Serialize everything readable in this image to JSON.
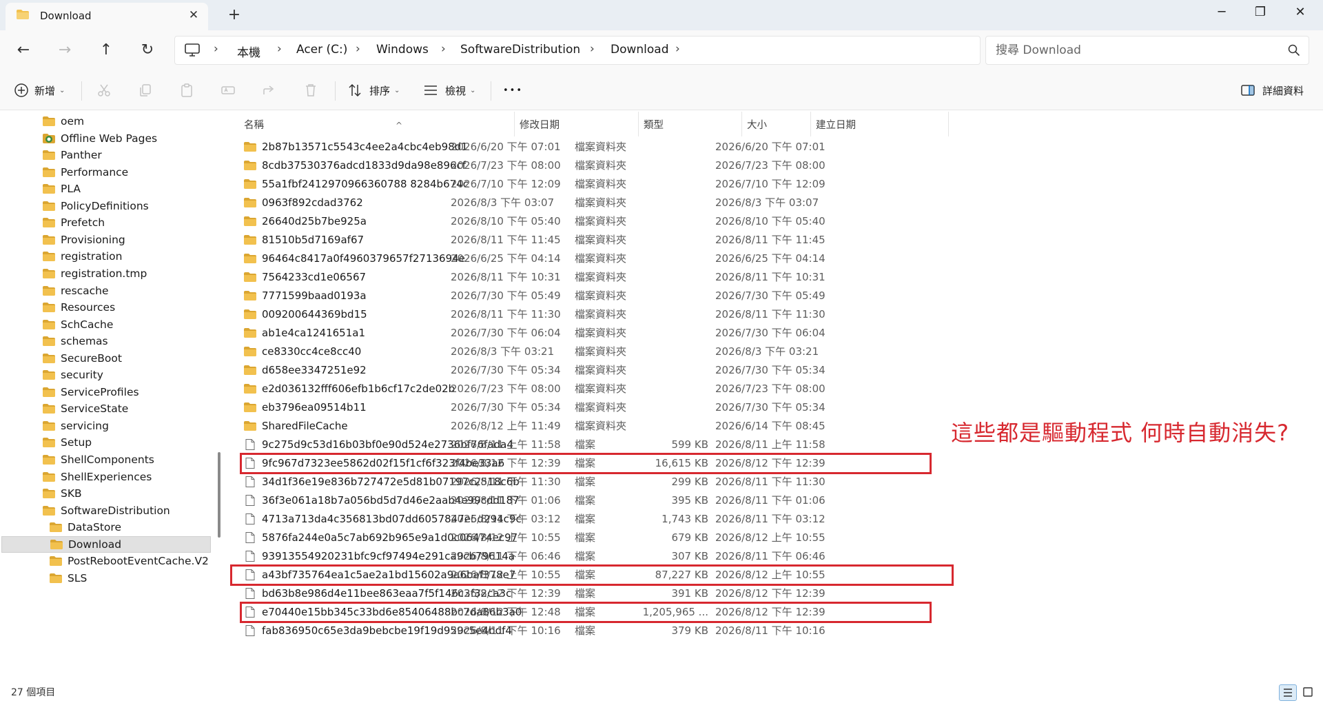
{
  "window": {
    "tab_title": "Download",
    "new_tab_glyph": "+",
    "close_tab_glyph": "✕",
    "minimize_glyph": "─",
    "restore_glyph": "❐",
    "close_glyph": "✕"
  },
  "nav": {
    "back_glyph": "←",
    "forward_glyph": "→",
    "up_glyph": "↑",
    "refresh_glyph": "↻",
    "separator_glyph": "›",
    "breadcrumbs": [
      "本機",
      "Acer (C:)",
      "Windows",
      "SoftwareDistribution",
      "Download"
    ],
    "search_placeholder": "搜尋 Download"
  },
  "commandbar": {
    "new_label": "新增",
    "sort_label": "排序",
    "view_label": "檢視",
    "more_label": "•••",
    "details_label": "詳細資料",
    "chevron": "⌄"
  },
  "tree": [
    {
      "label": "oem",
      "level": 1
    },
    {
      "label": "Offline Web Pages",
      "level": 1,
      "special": true
    },
    {
      "label": "Panther",
      "level": 1
    },
    {
      "label": "Performance",
      "level": 1
    },
    {
      "label": "PLA",
      "level": 1
    },
    {
      "label": "PolicyDefinitions",
      "level": 1
    },
    {
      "label": "Prefetch",
      "level": 1
    },
    {
      "label": "Provisioning",
      "level": 1
    },
    {
      "label": "registration",
      "level": 1
    },
    {
      "label": "registration.tmp",
      "level": 1
    },
    {
      "label": "rescache",
      "level": 1
    },
    {
      "label": "Resources",
      "level": 1
    },
    {
      "label": "SchCache",
      "level": 1
    },
    {
      "label": "schemas",
      "level": 1
    },
    {
      "label": "SecureBoot",
      "level": 1
    },
    {
      "label": "security",
      "level": 1
    },
    {
      "label": "ServiceProfiles",
      "level": 1
    },
    {
      "label": "ServiceState",
      "level": 1
    },
    {
      "label": "servicing",
      "level": 1
    },
    {
      "label": "Setup",
      "level": 1
    },
    {
      "label": "ShellComponents",
      "level": 1
    },
    {
      "label": "ShellExperiences",
      "level": 1
    },
    {
      "label": "SKB",
      "level": 1
    },
    {
      "label": "SoftwareDistribution",
      "level": 1
    },
    {
      "label": "DataStore",
      "level": 2
    },
    {
      "label": "Download",
      "level": 2,
      "selected": true
    },
    {
      "label": "PostRebootEventCache.V2",
      "level": 2
    },
    {
      "label": "SLS",
      "level": 2
    }
  ],
  "columns": {
    "name": "名稱",
    "modified": "修改日期",
    "type": "類型",
    "size": "大小",
    "created": "建立日期",
    "sort_glyph": "^"
  },
  "files": [
    {
      "name": "2b87b13571c5543c4ee2a4cbc4eb98d1",
      "modified": "2026/6/20 下午 07:01",
      "type": "檔案資料夾",
      "size": "",
      "created": "2026/6/20 下午 07:01",
      "kind": "folder"
    },
    {
      "name": "8cdb37530376adcd1833d9da98e896cf",
      "modified": "2026/7/23 下午 08:00",
      "type": "檔案資料夾",
      "size": "",
      "created": "2026/7/23 下午 08:00",
      "kind": "folder"
    },
    {
      "name": "55a1fbf2412970966360788 8284b674c",
      "modified": "2026/7/10 下午 12:09",
      "type": "檔案資料夾",
      "size": "",
      "created": "2026/7/10 下午 12:09",
      "kind": "folder"
    },
    {
      "name": "0963f892cdad3762",
      "modified": "2026/8/3 下午 03:07",
      "type": "檔案資料夾",
      "size": "",
      "created": "2026/8/3 下午 03:07",
      "kind": "folder"
    },
    {
      "name": "26640d25b7be925a",
      "modified": "2026/8/10 下午 05:40",
      "type": "檔案資料夾",
      "size": "",
      "created": "2026/8/10 下午 05:40",
      "kind": "folder"
    },
    {
      "name": "81510b5d7169af67",
      "modified": "2026/8/11 下午 11:45",
      "type": "檔案資料夾",
      "size": "",
      "created": "2026/8/11 下午 11:45",
      "kind": "folder"
    },
    {
      "name": "96464c8417a0f4960379657f2713694e",
      "modified": "2026/6/25 下午 04:14",
      "type": "檔案資料夾",
      "size": "",
      "created": "2026/6/25 下午 04:14",
      "kind": "folder"
    },
    {
      "name": "7564233cd1e06567",
      "modified": "2026/8/11 下午 10:31",
      "type": "檔案資料夾",
      "size": "",
      "created": "2026/8/11 下午 10:31",
      "kind": "folder"
    },
    {
      "name": "7771599baad0193a",
      "modified": "2026/7/30 下午 05:49",
      "type": "檔案資料夾",
      "size": "",
      "created": "2026/7/30 下午 05:49",
      "kind": "folder"
    },
    {
      "name": "009200644369bd15",
      "modified": "2026/8/11 下午 11:30",
      "type": "檔案資料夾",
      "size": "",
      "created": "2026/8/11 下午 11:30",
      "kind": "folder"
    },
    {
      "name": "ab1e4ca1241651a1",
      "modified": "2026/7/30 下午 06:04",
      "type": "檔案資料夾",
      "size": "",
      "created": "2026/7/30 下午 06:04",
      "kind": "folder"
    },
    {
      "name": "ce8330cc4ce8cc40",
      "modified": "2026/8/3 下午 03:21",
      "type": "檔案資料夾",
      "size": "",
      "created": "2026/8/3 下午 03:21",
      "kind": "folder"
    },
    {
      "name": "d658ee3347251e92",
      "modified": "2026/7/30 下午 05:34",
      "type": "檔案資料夾",
      "size": "",
      "created": "2026/7/30 下午 05:34",
      "kind": "folder"
    },
    {
      "name": "e2d036132fff606efb1b6cf17c2de02b",
      "modified": "2026/7/23 下午 08:00",
      "type": "檔案資料夾",
      "size": "",
      "created": "2026/7/23 下午 08:00",
      "kind": "folder"
    },
    {
      "name": "eb3796ea09514b11",
      "modified": "2026/7/30 下午 05:34",
      "type": "檔案資料夾",
      "size": "",
      "created": "2026/7/30 下午 05:34",
      "kind": "folder"
    },
    {
      "name": "SharedFileCache",
      "modified": "2026/8/12 上午 11:49",
      "type": "檔案資料夾",
      "size": "",
      "created": "2026/6/14 下午 08:45",
      "kind": "folder"
    },
    {
      "name": "9c275d9c53d16b03bf0e90d524e2736bf76fada4",
      "modified": "2026/8/11 上午 11:58",
      "type": "檔案",
      "size": "599 KB",
      "created": "2026/8/11 上午 11:58",
      "kind": "file"
    },
    {
      "name": "9fc967d7323ee5862d02f15f1cf6f323f4be33a6",
      "modified": "2026/8/12 下午 12:39",
      "type": "檔案",
      "size": "16,615 KB",
      "created": "2026/8/12 下午 12:39",
      "kind": "file"
    },
    {
      "name": "34d1f36e19e836b727472e5d81b07197c2518c6b",
      "modified": "2026/8/11 下午 11:30",
      "type": "檔案",
      "size": "299 KB",
      "created": "2026/8/11 下午 11:30",
      "kind": "file"
    },
    {
      "name": "36f3e061a18b7a056bd5d7d46e2aab4e99cdd187",
      "modified": "2026/8/11 下午 01:06",
      "type": "檔案",
      "size": "395 KB",
      "created": "2026/8/11 下午 01:06",
      "kind": "file"
    },
    {
      "name": "4713a713da4c356813bd07dd6057847e5d294c9c",
      "modified": "2026/8/11 下午 03:12",
      "type": "檔案",
      "size": "1,743 KB",
      "created": "2026/8/11 下午 03:12",
      "kind": "file"
    },
    {
      "name": "5876fa244e0a5c7ab692b965e9a1d0c06474ec97",
      "modified": "2026/8/12 上午 10:55",
      "type": "檔案",
      "size": "679 KB",
      "created": "2026/8/12 上午 10:55",
      "kind": "file"
    },
    {
      "name": "93913554920231bfc9cf97494e291ca9cb79614a",
      "modified": "2026/8/11 下午 06:46",
      "type": "檔案",
      "size": "307 KB",
      "created": "2026/8/11 下午 06:46",
      "kind": "file"
    },
    {
      "name": "a43bf735764ea1c5ae2a1bd15602a9a6baf378e7",
      "modified": "2026/8/12 上午 10:55",
      "type": "檔案",
      "size": "87,227 KB",
      "created": "2026/8/12 上午 10:55",
      "kind": "file"
    },
    {
      "name": "bd63b8e986d4e11bee863eaa7f5f146c3f32ca3c",
      "modified": "2026/8/12 下午 12:39",
      "type": "檔案",
      "size": "391 KB",
      "created": "2026/8/12 下午 12:39",
      "kind": "file"
    },
    {
      "name": "e70440e15bb345c33bd6e85406488bc7da86b3a0",
      "modified": "2026/8/12 下午 12:48",
      "type": "檔案",
      "size": "1,205,965 ...",
      "created": "2026/8/12 下午 12:39",
      "kind": "file"
    },
    {
      "name": "fab836950c65e3da9bebcbe19f19d959c5e4bdf4",
      "modified": "2026/8/11 下午 10:16",
      "type": "檔案",
      "size": "379 KB",
      "created": "2026/8/11 下午 10:16",
      "kind": "file"
    }
  ],
  "annotation": {
    "text": "這些都是驅動程式 何時自動消失?",
    "color": "#d7282f",
    "highlighted_rows": [
      17,
      23,
      25
    ]
  },
  "status": {
    "item_count": "27 個項目"
  },
  "colors": {
    "folder": "#f2c14e",
    "folder_dark": "#dba631",
    "accent": "#0067c0",
    "selection": "#e1e1e1"
  }
}
